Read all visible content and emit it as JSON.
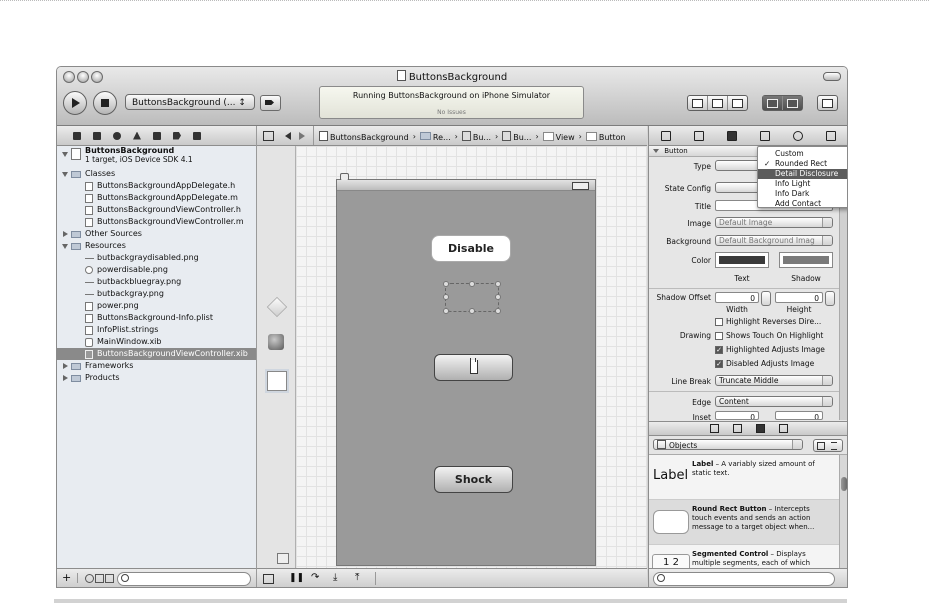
{
  "window": {
    "title": "ButtonsBackground",
    "scheme": "ButtonsBackground (... ↕",
    "activity_line1": "Running ButtonsBackground on iPhone Simulator",
    "activity_line2": "No Issues"
  },
  "navigator": {
    "project_name": "ButtonsBackground",
    "project_sub": "1 target, iOS Device SDK 4.1",
    "groups": {
      "classes": "Classes",
      "other_sources": "Other Sources",
      "resources": "Resources",
      "frameworks": "Frameworks",
      "products": "Products"
    },
    "class_files": [
      "ButtonsBackgroundAppDelegate.h",
      "ButtonsBackgroundAppDelegate.m",
      "ButtonsBackgroundViewController.h",
      "ButtonsBackgroundViewController.m"
    ],
    "resource_files": [
      "butbackgraydisabled.png",
      "powerdisable.png",
      "butbackbluegray.png",
      "butbackgray.png",
      "power.png",
      "ButtonsBackground-Info.plist",
      "InfoPlist.strings",
      "MainWindow.xib",
      "ButtonsBackgroundViewController.xib"
    ]
  },
  "jumpbar": {
    "crumbs": [
      "ButtonsBackground",
      "Re...",
      "Bu...",
      "Bu...",
      "View",
      "Button"
    ]
  },
  "canvas": {
    "disable_label": "Disable",
    "shock_label": "Shock"
  },
  "inspector": {
    "section": "Button",
    "type_label": "Type",
    "state_label": "State Config",
    "title_label": "Title",
    "image_label": "Image",
    "image_value": "Default Image",
    "background_label": "Background",
    "background_value": "Default Background Imag",
    "color_label": "Color",
    "text_caption": "Text",
    "shadow_caption": "Shadow",
    "shadow_offset_label": "Shadow Offset",
    "width_value": "0",
    "height_value": "0",
    "width_caption": "Width",
    "height_caption": "Height",
    "drawing_label": "Drawing",
    "checks": [
      {
        "label": "Highlight Reverses Dire...",
        "checked": false
      },
      {
        "label": "Shows Touch On Highlight",
        "checked": false
      },
      {
        "label": "Highlighted Adjusts Image",
        "checked": true
      },
      {
        "label": "Disabled Adjusts Image",
        "checked": true
      }
    ],
    "line_break_label": "Line Break",
    "line_break_value": "Truncate Middle",
    "edge_label": "Edge",
    "edge_value": "Content",
    "inset_label": "Inset",
    "inset_values": [
      "0",
      "0"
    ],
    "text_color": "#3a3a3a",
    "shadow_color": "#7a7a7a"
  },
  "type_menu": {
    "items": [
      {
        "label": "Custom",
        "checked": false,
        "highlighted": false
      },
      {
        "label": "Rounded Rect",
        "checked": true,
        "highlighted": false
      },
      {
        "label": "Detail Disclosure",
        "checked": false,
        "highlighted": true
      },
      {
        "label": "Info Light",
        "checked": false,
        "highlighted": false
      },
      {
        "label": "Info Dark",
        "checked": false,
        "highlighted": false
      },
      {
        "label": "Add Contact",
        "checked": false,
        "highlighted": false
      }
    ]
  },
  "library": {
    "filter": "Objects",
    "items": [
      {
        "icon_text": "Label",
        "title": "Label",
        "desc": " – A variably sized amount of static text."
      },
      {
        "icon_text": "",
        "title": "Round Rect Button",
        "desc": " – Intercepts touch events and sends an action message to a target object when..."
      },
      {
        "icon_text": "1 2",
        "title": "Segmented Control",
        "desc": " – Displays multiple segments, each of which"
      }
    ]
  }
}
